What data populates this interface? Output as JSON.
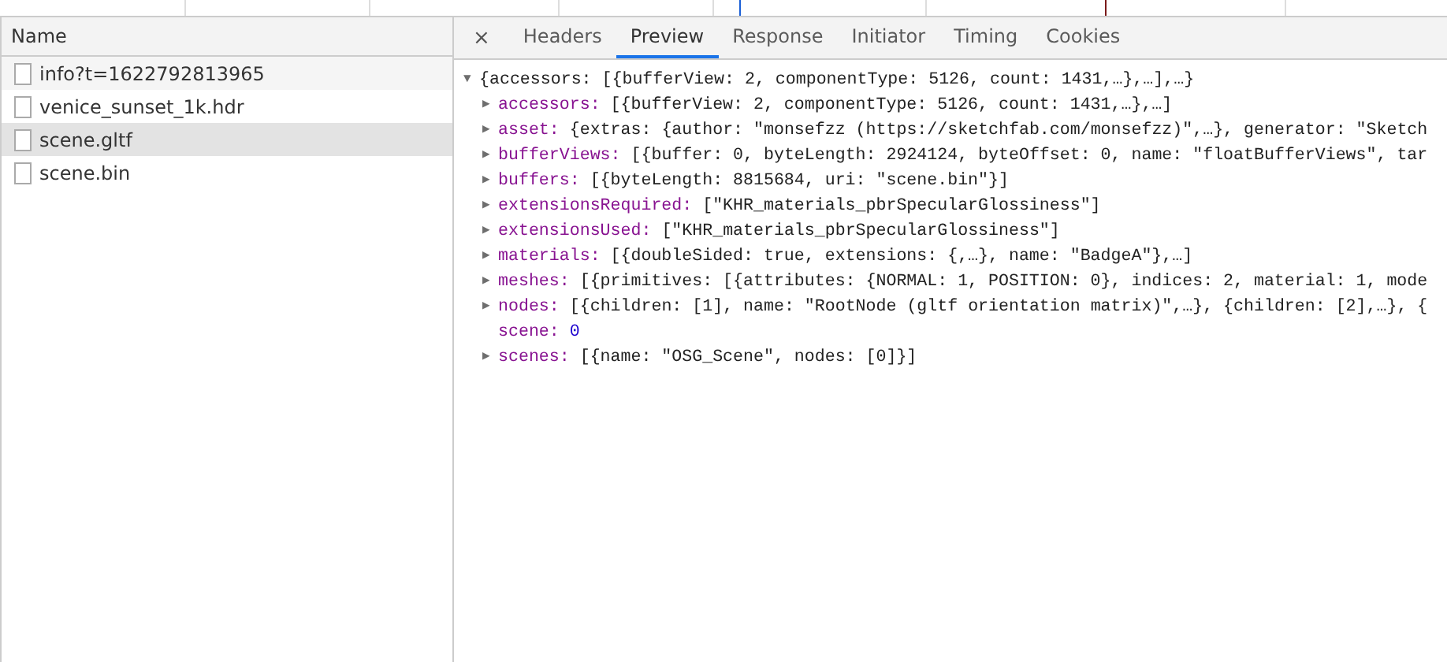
{
  "requests": {
    "column": "Name",
    "items": [
      {
        "name": "info?t=1622792813965",
        "selected": false
      },
      {
        "name": "venice_sunset_1k.hdr",
        "selected": false
      },
      {
        "name": "scene.gltf",
        "selected": true
      },
      {
        "name": "scene.bin",
        "selected": false
      }
    ]
  },
  "detail": {
    "close": "×",
    "tabs": [
      {
        "label": "Headers",
        "selected": false
      },
      {
        "label": "Preview",
        "selected": true
      },
      {
        "label": "Response",
        "selected": false
      },
      {
        "label": "Initiator",
        "selected": false
      },
      {
        "label": "Timing",
        "selected": false
      },
      {
        "label": "Cookies",
        "selected": false
      }
    ],
    "preview": {
      "toggle": "▼",
      "summary": "{accessors: [{bufferView: 2, componentType: 5126, count: 1431,…},…],…}",
      "children": [
        {
          "kind": "object",
          "toggle": "▶",
          "key": "accessors:",
          "value": "[{bufferView: 2, componentType: 5126, count: 1431,…},…]"
        },
        {
          "kind": "object",
          "toggle": "▶",
          "key": "asset:",
          "value": "{extras: {author: \"monsefzz (https://sketchfab.com/monsefzz)\",…}, generator: \"Sketch"
        },
        {
          "kind": "object",
          "toggle": "▶",
          "key": "bufferViews:",
          "value": "[{buffer: 0, byteLength: 2924124, byteOffset: 0, name: \"floatBufferViews\", tar"
        },
        {
          "kind": "object",
          "toggle": "▶",
          "key": "buffers:",
          "value": "[{byteLength: 8815684, uri: \"scene.bin\"}]"
        },
        {
          "kind": "object",
          "toggle": "▶",
          "key": "extensionsRequired:",
          "value": "[\"KHR_materials_pbrSpecularGlossiness\"]"
        },
        {
          "kind": "object",
          "toggle": "▶",
          "key": "extensionsUsed:",
          "value": "[\"KHR_materials_pbrSpecularGlossiness\"]"
        },
        {
          "kind": "object",
          "toggle": "▶",
          "key": "materials:",
          "value": "[{doubleSided: true, extensions: {,…}, name: \"BadgeA\"},…]"
        },
        {
          "kind": "object",
          "toggle": "▶",
          "key": "meshes:",
          "value": "[{primitives: [{attributes: {NORMAL: 1, POSITION: 0}, indices: 2, material: 1, mode"
        },
        {
          "kind": "object",
          "toggle": "▶",
          "key": "nodes:",
          "value": "[{children: [1], name: \"RootNode (gltf orientation matrix)\",…}, {children: [2],…}, {"
        },
        {
          "kind": "number",
          "key": "scene:",
          "value": "0"
        },
        {
          "kind": "object",
          "toggle": "▶",
          "key": "scenes:",
          "value": "[{name: \"OSG_Scene\", nodes: [0]}]"
        }
      ]
    }
  }
}
